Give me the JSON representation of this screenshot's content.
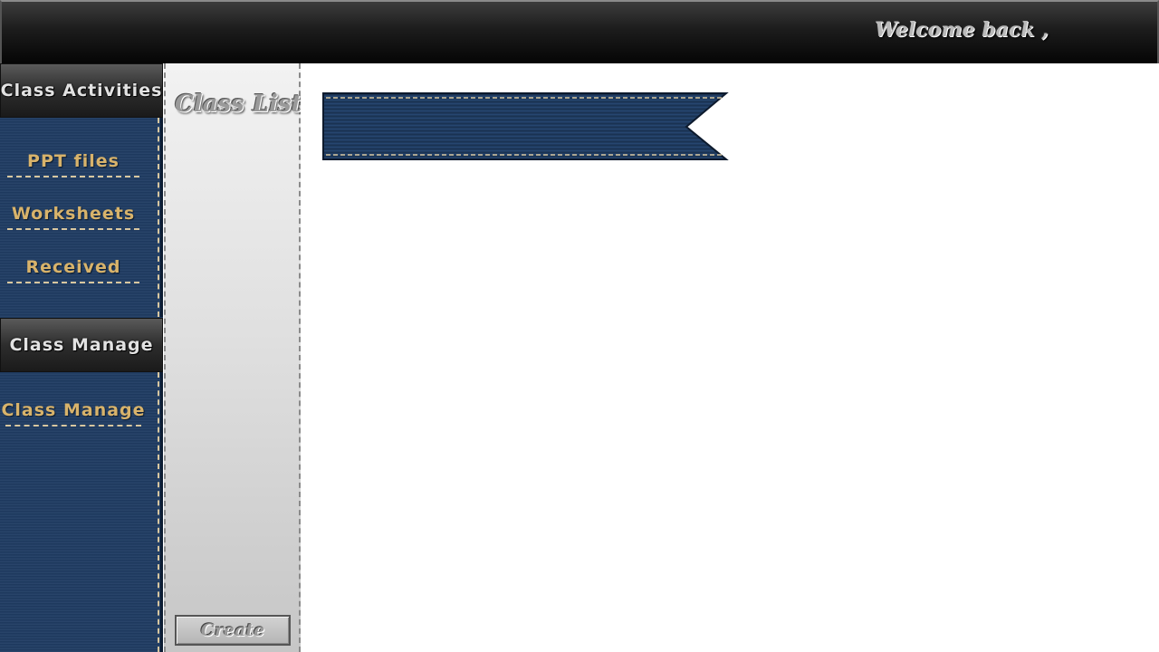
{
  "header": {
    "welcome_text": "Welcome back ,"
  },
  "sidebar": {
    "sections": [
      {
        "title": "Class Activities",
        "items": [
          {
            "label": "PPT files"
          },
          {
            "label": "Worksheets"
          },
          {
            "label": "Received"
          }
        ]
      },
      {
        "title": "Class Manage",
        "items": [
          {
            "label": "Class Manage"
          }
        ]
      }
    ]
  },
  "class_list": {
    "title": "Class List",
    "create_label": "Create"
  },
  "main": {
    "banner_text": ""
  },
  "colors": {
    "denim": "#203d64",
    "stitch": "#d8c7a0",
    "nav_text": "#d8b36b",
    "ribbon": "#1f3a5f"
  }
}
